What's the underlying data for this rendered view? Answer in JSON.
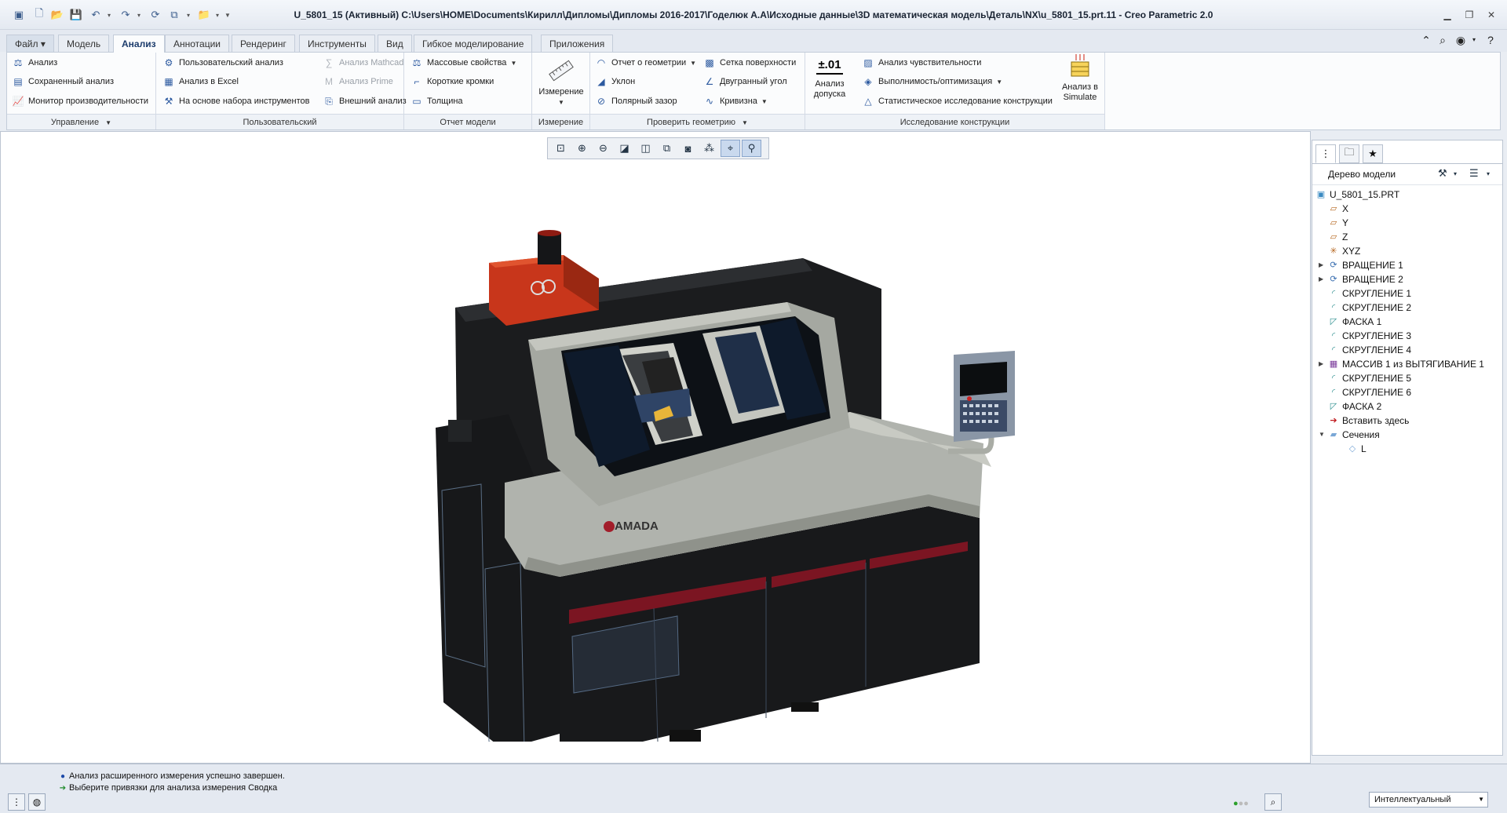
{
  "titlebar": {
    "title": "U_5801_15 (Активный) C:\\Users\\HOME\\Documents\\Кирилл\\Дипломы\\Дипломы 2016-2017\\Годелюк А.А\\Исходные данные\\3D математическая модель\\Деталь\\NX\\u_5801_15.prt.11 - Creo Parametric 2.0"
  },
  "tabs": [
    "Файл",
    "Модель",
    "Анализ",
    "Аннотации",
    "Рендеринг",
    "Инструменты",
    "Вид",
    "Гибкое моделирование",
    "Приложения"
  ],
  "active_tab": "Анализ",
  "ribbon": {
    "manage": {
      "title": "Управление",
      "items": [
        "Анализ",
        "Сохраненный анализ",
        "Монитор производительности"
      ]
    },
    "custom": {
      "title": "Пользовательский",
      "items": [
        "Пользовательский анализ",
        "Анализ в Excel",
        "На основе набора инструментов",
        "Анализ Mathcad",
        "Анализ Prime",
        "Внешний анализ"
      ]
    },
    "model_report": {
      "title": "Отчет модели",
      "items": [
        "Массовые свойства",
        "Короткие кромки",
        "Толщина"
      ]
    },
    "measure": {
      "title": "Измерение",
      "label": "Измерение"
    },
    "inspect": {
      "title": "Проверить геометрию",
      "items": [
        "Отчет о геометрии",
        "Уклон",
        "Полярный зазор",
        "Сетка поверхности",
        "Двугранный угол",
        "Кривизна"
      ]
    },
    "design": {
      "title": "Исследование конструкции",
      "tolerance_icon_text": "±.01",
      "tolerance_label": "Анализ допуска",
      "items": [
        "Анализ чувствительности",
        "Выполнимость/оптимизация",
        "Статистическое исследование конструкции"
      ],
      "simulate_label": "Анализ в Simulate"
    }
  },
  "model": {
    "brand": "AMADA"
  },
  "tree": {
    "header": "Дерево модели",
    "nodes": [
      {
        "label": "U_5801_15.PRT",
        "icon": "part-icon",
        "level": 0,
        "expand": ""
      },
      {
        "label": "X",
        "icon": "datum-plane-icon",
        "level": 1,
        "expand": ""
      },
      {
        "label": "Y",
        "icon": "datum-plane-icon",
        "level": 1,
        "expand": ""
      },
      {
        "label": "Z",
        "icon": "datum-plane-icon",
        "level": 1,
        "expand": ""
      },
      {
        "label": "XYZ",
        "icon": "coordinate-system-icon",
        "level": 1,
        "expand": ""
      },
      {
        "label": "ВРАЩЕНИЕ 1",
        "icon": "revolve-icon",
        "level": 1,
        "expand": "▶"
      },
      {
        "label": "ВРАЩЕНИЕ 2",
        "icon": "revolve-icon",
        "level": 1,
        "expand": "▶"
      },
      {
        "label": "СКРУГЛЕНИЕ 1",
        "icon": "round-icon",
        "level": 1,
        "expand": ""
      },
      {
        "label": "СКРУГЛЕНИЕ 2",
        "icon": "round-icon",
        "level": 1,
        "expand": ""
      },
      {
        "label": "ФАСКА 1",
        "icon": "chamfer-icon",
        "level": 1,
        "expand": ""
      },
      {
        "label": "СКРУГЛЕНИЕ 3",
        "icon": "round-icon",
        "level": 1,
        "expand": ""
      },
      {
        "label": "СКРУГЛЕНИЕ 4",
        "icon": "round-icon",
        "level": 1,
        "expand": ""
      },
      {
        "label": "МАССИВ 1 из ВЫТЯГИВАНИЕ 1",
        "icon": "pattern-icon",
        "level": 1,
        "expand": "▶"
      },
      {
        "label": "СКРУГЛЕНИЕ 5",
        "icon": "round-icon",
        "level": 1,
        "expand": ""
      },
      {
        "label": "СКРУГЛЕНИЕ 6",
        "icon": "round-icon",
        "level": 1,
        "expand": ""
      },
      {
        "label": "ФАСКА 2",
        "icon": "chamfer-icon",
        "level": 1,
        "expand": ""
      },
      {
        "label": "Вставить здесь",
        "icon": "insert-arrow-icon",
        "level": 1,
        "expand": ""
      },
      {
        "label": "Сечения",
        "icon": "folder-icon",
        "level": 1,
        "expand": "▼"
      },
      {
        "label": "L",
        "icon": "section-icon",
        "level": 2,
        "expand": ""
      }
    ]
  },
  "status": {
    "messages": [
      "Анализ расширенного измерения успешно завершен.",
      "Выберите привязки для анализа измерения Сводка"
    ],
    "filter": "Интеллектуальный"
  },
  "colors": {
    "accent": "#2d5aa0",
    "body_dark": "#1b1c1e",
    "machine_red": "#c8361b",
    "cover_gray": "#a9aca5"
  }
}
